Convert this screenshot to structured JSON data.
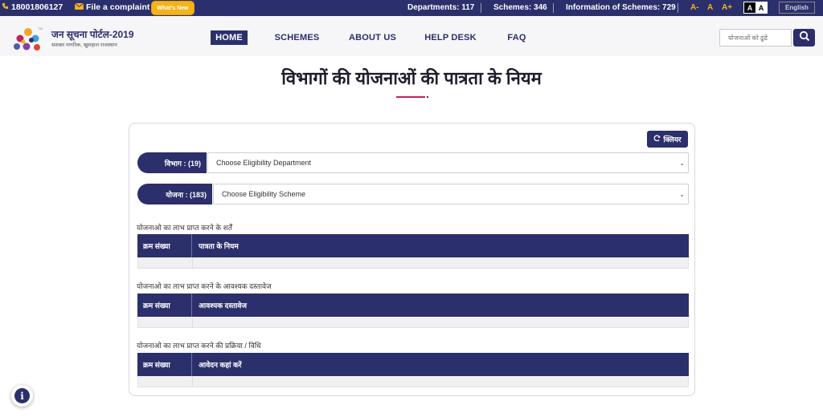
{
  "topbar": {
    "phone": "18001806127",
    "complaint": "File a complaint",
    "whats_new": "What's New",
    "departments": "Departments: 117",
    "schemes": "Schemes: 346",
    "information": "Information of Schemes: 729",
    "font_decrease": "A-",
    "font_normal": "A",
    "font_increase": "A+",
    "contrast_dark": "A",
    "contrast_light": "A",
    "language": "English"
  },
  "brand": {
    "title": "जन सूचना पोर्टल-2019",
    "tagline": "सशक्त नागरिक, खुशहाल राजस्थान"
  },
  "nav": {
    "home": "HOME",
    "schemes": "SCHEMES",
    "about": "ABOUT US",
    "helpdesk": "HELP DESK",
    "faq": "FAQ"
  },
  "search": {
    "placeholder": "योजनाओं को ढूंढें"
  },
  "page": {
    "title": "विभागों की योजनाओं की पात्रता के नियम"
  },
  "filters": {
    "clear_label": "क्लियर",
    "department_label": "विभाग : (19)",
    "department_value": "Choose Eligibility Department",
    "scheme_label": "योजना : (183)",
    "scheme_value": "Choose Eligibility Scheme"
  },
  "sections": [
    {
      "title": "योजनाओ का लाभ प्राप्त करने के शर्तें",
      "col1": "क्रम संख्या",
      "col2": "पात्रता के नियम"
    },
    {
      "title": "योजनाओ का लाभ प्राप्त करने के आवश्यक दस्तावेज",
      "col1": "क्रम संख्या",
      "col2": "आवश्यक दस्तावेज"
    },
    {
      "title": "योजनाओ का लाभ प्राप्त करने की प्रक्रिया / विधि",
      "col1": "क्रम संख्या",
      "col2": "आवेदन कहां करें"
    }
  ],
  "colors": {
    "primary": "#2b2f6b",
    "accent": "#f5b31b",
    "underline": "#c0245a"
  },
  "icons": [
    "phone-icon",
    "mail-icon",
    "search-icon",
    "refresh-icon",
    "info-icon",
    "logo-icon"
  ]
}
